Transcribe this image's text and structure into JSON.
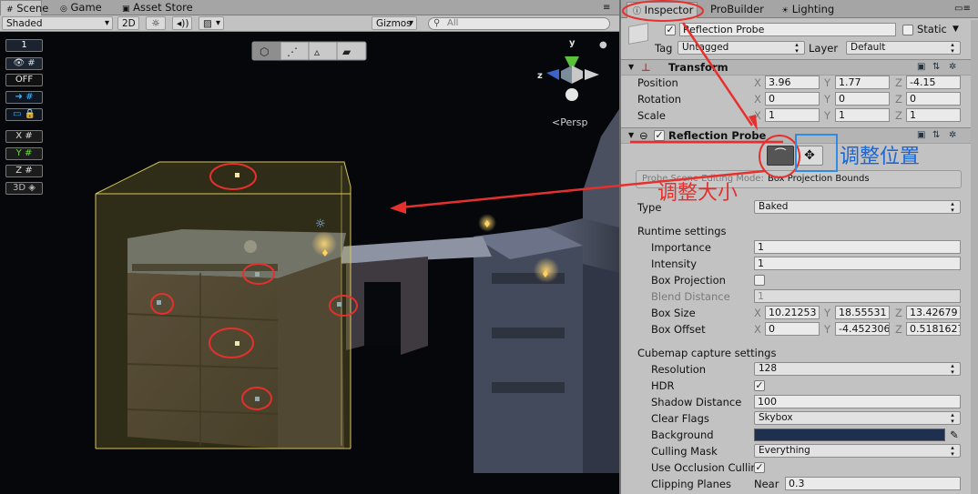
{
  "scene": {
    "tabs": [
      {
        "label": "Scene",
        "icon": "scene-icon"
      },
      {
        "label": "Game",
        "icon": "game-icon"
      },
      {
        "label": "Asset Store",
        "icon": "asset-store-icon"
      }
    ],
    "shading_mode": "Shaded",
    "toolbar_2d": "2D",
    "gizmos_label": "Gizmos",
    "search_placeholder": "All",
    "left_tools": {
      "layer_number": "1",
      "off_label": "OFF",
      "axis_x": "X",
      "axis_y": "Y",
      "axis_z": "Z",
      "toggle_3d": "3D"
    },
    "gizmo": {
      "y": "y",
      "z": "z",
      "persp": "Persp"
    }
  },
  "inspector": {
    "tabs": [
      "Inspector",
      "ProBuilder",
      "Lighting"
    ],
    "object_name": "Reflection Probe",
    "active_checked": true,
    "static_label": "Static",
    "tag_label": "Tag",
    "tag_value": "Untagged",
    "layer_label": "Layer",
    "layer_value": "Default",
    "transform": {
      "title": "Transform",
      "position_label": "Position",
      "rotation_label": "Rotation",
      "scale_label": "Scale",
      "position": {
        "x": "3.96",
        "y": "1.77",
        "z": "-4.15"
      },
      "rotation": {
        "x": "0",
        "y": "0",
        "z": "0"
      },
      "scale": {
        "x": "1",
        "y": "1",
        "z": "1"
      }
    },
    "reflection_probe": {
      "title": "Reflection Probe",
      "editing_mode_label": "Probe Scene Editing Mode:",
      "editing_mode_value": "Box Projection Bounds",
      "type_label": "Type",
      "type_value": "Baked",
      "runtime_settings": "Runtime settings",
      "importance_label": "Importance",
      "importance": "1",
      "intensity_label": "Intensity",
      "intensity": "1",
      "box_projection_label": "Box Projection",
      "blend_distance_label": "Blend Distance",
      "blend_distance": "1",
      "box_size_label": "Box Size",
      "box_size": {
        "x": "10.21253",
        "y": "18.55531",
        "z": "13.42679"
      },
      "box_offset_label": "Box Offset",
      "box_offset": {
        "x": "0",
        "y": "-4.452306",
        "z": "0.5181627"
      },
      "cubemap_settings": "Cubemap capture settings",
      "resolution_label": "Resolution",
      "resolution": "128",
      "hdr_label": "HDR",
      "shadow_distance_label": "Shadow Distance",
      "shadow_distance": "100",
      "clear_flags_label": "Clear Flags",
      "clear_flags": "Skybox",
      "background_label": "Background",
      "background_color": "#1f2f4f",
      "culling_mask_label": "Culling Mask",
      "culling_mask": "Everything",
      "use_occlusion_label": "Use Occlusion Cullin",
      "clipping_planes_label": "Clipping Planes",
      "near_label": "Near",
      "near": "0.3"
    }
  },
  "annotations": {
    "adjust_position": "调整位置",
    "adjust_size": "调整大小"
  },
  "colors": {
    "annotation_red": "#e6302d",
    "annotation_blue": "#1a66d6",
    "probe_box": "#d8c55a"
  }
}
